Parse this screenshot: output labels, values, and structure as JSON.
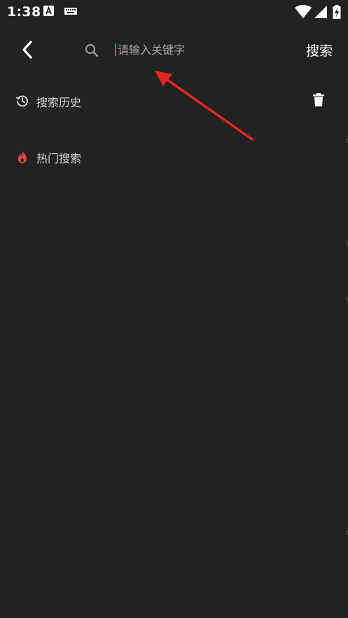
{
  "status_bar": {
    "time": "1:38",
    "icons": [
      "a-app-icon",
      "keyboard-icon",
      "wifi-icon",
      "signal-icon",
      "battery-charging-icon"
    ]
  },
  "app_bar": {
    "back_icon": "chevron-left-icon",
    "search_icon": "search-icon",
    "search_placeholder": "请输入关键字",
    "search_value": "",
    "search_button_label": "搜索"
  },
  "sections": {
    "history": {
      "icon": "history-icon",
      "label": "搜索历史",
      "clear_icon": "trash-icon"
    },
    "hot": {
      "icon": "flame-icon",
      "label": "热门搜索"
    }
  },
  "annotation": {
    "icon": "red-arrow-icon",
    "color": "#e8261f"
  },
  "colors": {
    "background": "#222222",
    "text_primary": "#ffffff",
    "text_secondary": "#d6d6d6",
    "placeholder": "#a8a8a8",
    "flame": "#e8473b",
    "caret": "#2f8f63"
  }
}
